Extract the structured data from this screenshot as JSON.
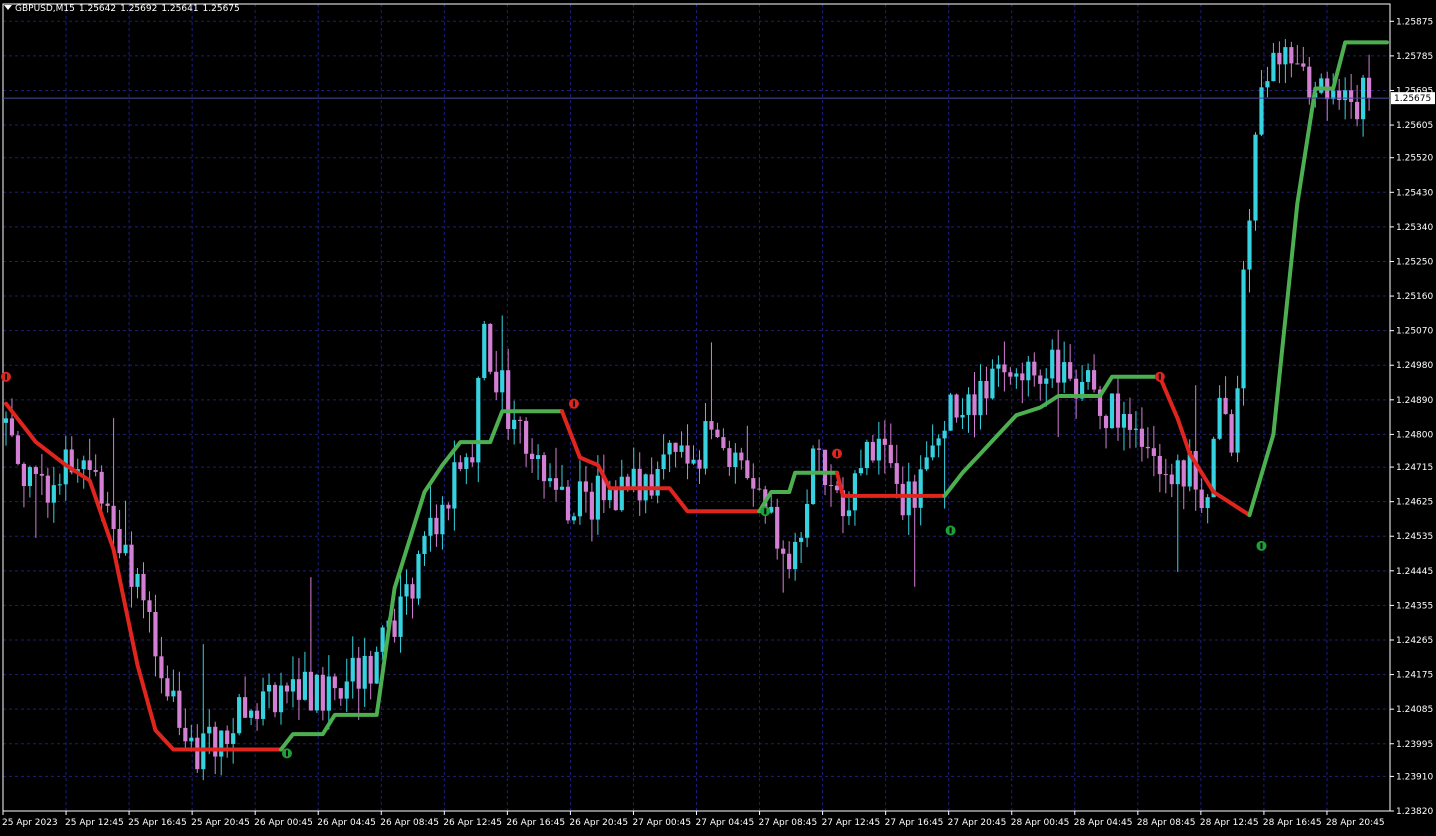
{
  "header": {
    "symbol": "GBPUSD,M15",
    "open": "1.25642",
    "high": "1.25692",
    "low": "1.25641",
    "close": "1.25675"
  },
  "current_price_label": "1.25675",
  "colors": {
    "background": "#000000",
    "grid": "#1e1e7a",
    "axis": "#ffffff",
    "bull_candle": "#36d2e0",
    "bear_candle": "#d37fd3",
    "trend_up": "#4caf50",
    "trend_down": "#e0241e",
    "signal_up": "#1f9e3a",
    "signal_down": "#e0241e",
    "current_price_line": "#4a4a9a"
  },
  "chart_data": {
    "type": "candlestick",
    "symbol": "GBPUSD",
    "timeframe": "M15",
    "y_ticks": [
      "1.25875",
      "1.25785",
      "1.25695",
      "1.25605",
      "1.25520",
      "1.25430",
      "1.25340",
      "1.25250",
      "1.25160",
      "1.25070",
      "1.24980",
      "1.24890",
      "1.24800",
      "1.24715",
      "1.24625",
      "1.24535",
      "1.24445",
      "1.24355",
      "1.24265",
      "1.24175",
      "1.24085",
      "1.23995",
      "1.23910",
      "1.23820"
    ],
    "ylim": [
      1.2382,
      1.2592
    ],
    "x_ticks": [
      "25 Apr 2023",
      "25 Apr 12:45",
      "25 Apr 16:45",
      "25 Apr 20:45",
      "26 Apr 00:45",
      "26 Apr 04:45",
      "26 Apr 08:45",
      "26 Apr 12:45",
      "26 Apr 16:45",
      "26 Apr 20:45",
      "27 Apr 00:45",
      "27 Apr 04:45",
      "27 Apr 08:45",
      "27 Apr 12:45",
      "27 Apr 16:45",
      "27 Apr 20:45",
      "28 Apr 00:45",
      "28 Apr 04:45",
      "28 Apr 08:45",
      "28 Apr 12:45",
      "28 Apr 16:45",
      "28 Apr 20:45"
    ],
    "price_path": [
      [
        0,
        1.2483
      ],
      [
        5,
        1.2465
      ],
      [
        10,
        1.2472
      ],
      [
        16,
        1.2468
      ],
      [
        22,
        1.2438
      ],
      [
        27,
        1.2415
      ],
      [
        32,
        1.2398
      ],
      [
        36,
        1.2402
      ],
      [
        40,
        1.2407
      ],
      [
        45,
        1.2413
      ],
      [
        50,
        1.2413
      ],
      [
        56,
        1.2414
      ],
      [
        62,
        1.2422
      ],
      [
        66,
        1.2432
      ],
      [
        70,
        1.2452
      ],
      [
        74,
        1.2465
      ],
      [
        78,
        1.2478
      ],
      [
        80,
        1.2508
      ],
      [
        84,
        1.2485
      ],
      [
        88,
        1.2475
      ],
      [
        92,
        1.2465
      ],
      [
        96,
        1.2462
      ],
      [
        100,
        1.2465
      ],
      [
        105,
        1.2467
      ],
      [
        110,
        1.2472
      ],
      [
        115,
        1.2475
      ],
      [
        118,
        1.248
      ],
      [
        121,
        1.2476
      ],
      [
        124,
        1.2467
      ],
      [
        127,
        1.2465
      ],
      [
        130,
        1.2447
      ],
      [
        133,
        1.2452
      ],
      [
        135,
        1.2475
      ],
      [
        138,
        1.2465
      ],
      [
        140,
        1.2455
      ],
      [
        143,
        1.2475
      ],
      [
        148,
        1.2478
      ],
      [
        150,
        1.246
      ],
      [
        154,
        1.247
      ],
      [
        158,
        1.2488
      ],
      [
        162,
        1.249
      ],
      [
        166,
        1.2496
      ],
      [
        170,
        1.2495
      ],
      [
        174,
        1.2497
      ],
      [
        178,
        1.2495
      ],
      [
        182,
        1.249
      ],
      [
        186,
        1.2485
      ],
      [
        190,
        1.2478
      ],
      [
        193,
        1.2472
      ],
      [
        195,
        1.2465
      ],
      [
        198,
        1.2472
      ],
      [
        201,
        1.2463
      ],
      [
        203,
        1.2484
      ],
      [
        205,
        1.2475
      ],
      [
        207,
        1.252
      ],
      [
        210,
        1.257
      ],
      [
        212,
        1.2575
      ],
      [
        214,
        1.2582
      ],
      [
        216,
        1.258
      ],
      [
        218,
        1.257
      ],
      [
        222,
        1.2566
      ],
      [
        226,
        1.2568
      ],
      [
        228,
        1.25675
      ]
    ],
    "trend_line": {
      "up_color_series": "uptrend",
      "down_color_series": "downtrend",
      "segments": [
        {
          "trend": "down",
          "points": [
            [
              0,
              1.2488
            ],
            [
              5,
              1.2478
            ],
            [
              10,
              1.2472
            ],
            [
              14,
              1.2468
            ],
            [
              18,
              1.245
            ],
            [
              22,
              1.242
            ],
            [
              25,
              1.2403
            ],
            [
              28,
              1.2398
            ],
            [
              46,
              1.2398
            ]
          ]
        },
        {
          "trend": "up",
          "points": [
            [
              46,
              1.2398
            ],
            [
              48,
              1.2402
            ],
            [
              53,
              1.2402
            ],
            [
              55,
              1.2407
            ],
            [
              62,
              1.2407
            ],
            [
              65,
              1.244
            ],
            [
              70,
              1.2465
            ],
            [
              73,
              1.2472
            ],
            [
              76,
              1.2478
            ],
            [
              81,
              1.2478
            ],
            [
              83,
              1.2486
            ],
            [
              93,
              1.2486
            ]
          ]
        },
        {
          "trend": "down",
          "points": [
            [
              93,
              1.2486
            ],
            [
              96,
              1.2474
            ],
            [
              99,
              1.2472
            ],
            [
              101,
              1.2466
            ],
            [
              111,
              1.2466
            ],
            [
              114,
              1.246
            ],
            [
              126,
              1.246
            ]
          ]
        },
        {
          "trend": "up",
          "points": [
            [
              126,
              1.246
            ],
            [
              128,
              1.2465
            ],
            [
              131,
              1.2465
            ],
            [
              132,
              1.247
            ],
            [
              139,
              1.247
            ]
          ]
        },
        {
          "trend": "down",
          "points": [
            [
              139,
              1.247
            ],
            [
              140,
              1.2464
            ],
            [
              157,
              1.2464
            ]
          ]
        },
        {
          "trend": "up",
          "points": [
            [
              157,
              1.2464
            ],
            [
              160,
              1.247
            ],
            [
              163,
              1.2475
            ],
            [
              166,
              1.248
            ],
            [
              169,
              1.2485
            ],
            [
              173,
              1.2487
            ],
            [
              176,
              1.249
            ],
            [
              183,
              1.249
            ],
            [
              185,
              1.2495
            ],
            [
              193,
              1.2495
            ]
          ]
        },
        {
          "trend": "down",
          "points": [
            [
              193,
              1.2495
            ],
            [
              196,
              1.2484
            ],
            [
              198,
              1.2475
            ],
            [
              202,
              1.2465
            ],
            [
              205,
              1.2462
            ],
            [
              208,
              1.2459
            ]
          ]
        },
        {
          "trend": "up",
          "points": [
            [
              208,
              1.2459
            ],
            [
              212,
              1.248
            ],
            [
              216,
              1.254
            ],
            [
              219,
              1.257
            ],
            [
              222,
              1.257
            ],
            [
              224,
              1.2582
            ],
            [
              231,
              1.2582
            ]
          ]
        }
      ]
    },
    "signals": [
      {
        "type": "down",
        "x": 0,
        "price": 1.2495
      },
      {
        "type": "down",
        "x": 95,
        "price": 1.2488
      },
      {
        "type": "up",
        "x": 47,
        "price": 1.2397
      },
      {
        "type": "up",
        "x": 127,
        "price": 1.246
      },
      {
        "type": "down",
        "x": 139,
        "price": 1.2475
      },
      {
        "type": "up",
        "x": 158,
        "price": 1.2455
      },
      {
        "type": "down",
        "x": 193,
        "price": 1.2495
      },
      {
        "type": "up",
        "x": 210,
        "price": 1.2451
      }
    ],
    "current_price": 1.25675,
    "grid": true
  }
}
